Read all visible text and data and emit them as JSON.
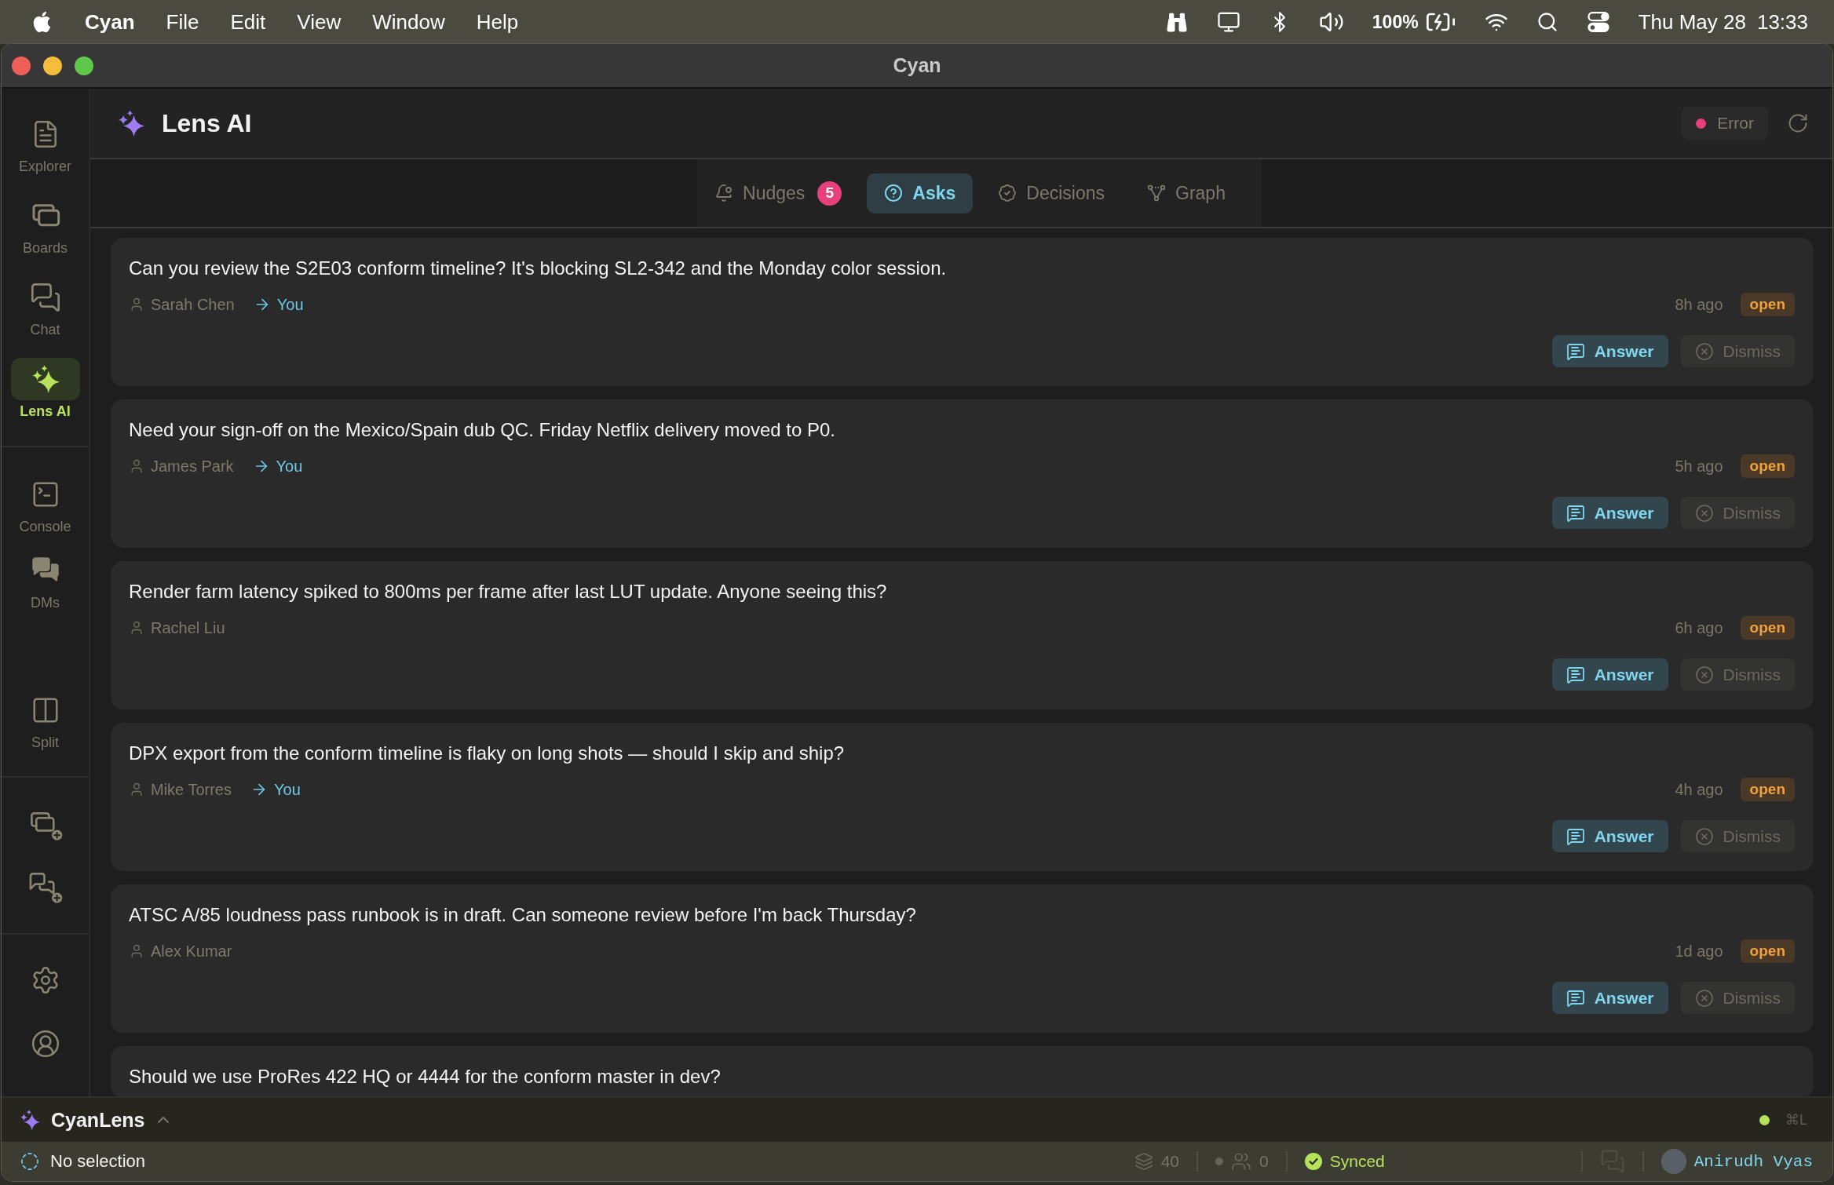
{
  "menu_bar": {
    "app_name": "Cyan",
    "menus": [
      "File",
      "Edit",
      "View",
      "Window",
      "Help"
    ],
    "battery": "100%",
    "date": "Thu May 28",
    "time": "13:33"
  },
  "window": {
    "title": "Cyan"
  },
  "sidebar": {
    "primary": [
      {
        "label": "Explorer",
        "selected": false
      },
      {
        "label": "Boards",
        "selected": false
      },
      {
        "label": "Chat",
        "selected": false
      },
      {
        "label": "Lens AI",
        "selected": true
      }
    ],
    "secondary": [
      {
        "label": "Console",
        "selected": false
      },
      {
        "label": "DMs",
        "selected": false
      },
      {
        "label": "Split",
        "selected": false
      }
    ]
  },
  "header": {
    "title": "Lens AI",
    "status": {
      "kind": "error",
      "label": "Error"
    }
  },
  "tabs": [
    {
      "label": "Nudges",
      "badge": "5",
      "selected": false
    },
    {
      "label": "Asks",
      "selected": true
    },
    {
      "label": "Decisions",
      "selected": false
    },
    {
      "label": "Graph",
      "selected": false
    }
  ],
  "asks": [
    {
      "question": "Can you review the S2E03 conform timeline? It's blocking SL2-342 and the Monday color session.",
      "author": "Sarah Chen",
      "recipient": "You",
      "age": "8h ago",
      "status": "open",
      "actions": [
        "Answer",
        "Dismiss"
      ]
    },
    {
      "question": "Need your sign-off on the Mexico/Spain dub QC. Friday Netflix delivery moved to P0.",
      "author": "James Park",
      "recipient": "You",
      "age": "5h ago",
      "status": "open",
      "actions": [
        "Answer",
        "Dismiss"
      ]
    },
    {
      "question": "Render farm latency spiked to 800ms per frame after last LUT update. Anyone seeing this?",
      "author": "Rachel Liu",
      "age": "6h ago",
      "status": "open",
      "actions": [
        "Answer",
        "Dismiss"
      ]
    },
    {
      "question": "DPX export from the conform timeline is flaky on long shots — should I skip and ship?",
      "author": "Mike Torres",
      "recipient": "You",
      "age": "4h ago",
      "status": "open",
      "actions": [
        "Answer",
        "Dismiss"
      ]
    },
    {
      "question": "ATSC A/85 loudness pass runbook is in draft. Can someone review before I'm back Thursday?",
      "author": "Alex Kumar",
      "age": "1d ago",
      "status": "open",
      "actions": [
        "Answer",
        "Dismiss"
      ]
    },
    {
      "question": "Should we use ProRes 422 HQ or 4444 for the conform master in dev?"
    }
  ],
  "lens_bar": {
    "title": "CyanLens",
    "expanded": false,
    "connected": true,
    "shortcut": "⌘L"
  },
  "status_bar": {
    "selection": "No selection",
    "layers": "40",
    "members": "0",
    "sync": "Synced",
    "user": "Anirudh Vyas"
  }
}
